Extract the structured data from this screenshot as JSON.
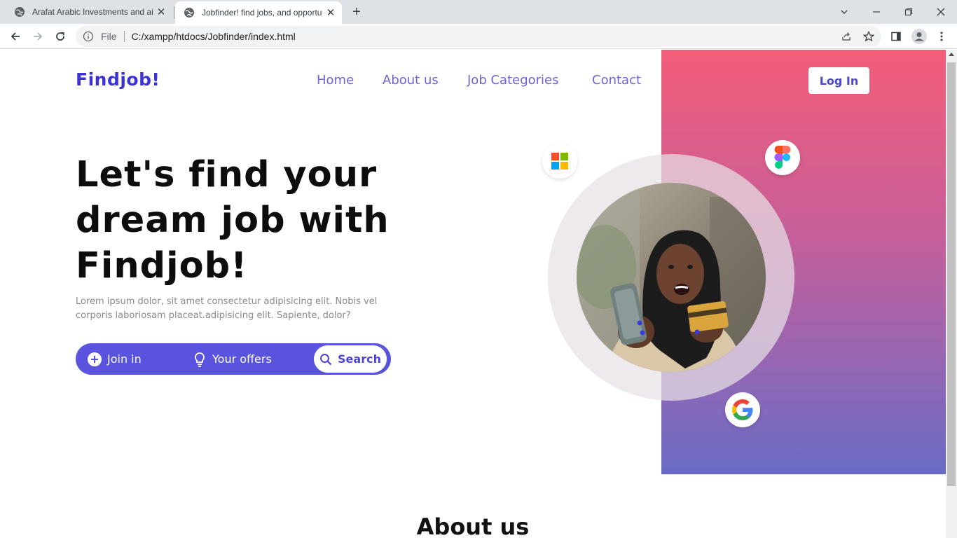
{
  "browser": {
    "tabs": [
      {
        "title": "Arafat Arabic Investments and ai",
        "active": false
      },
      {
        "title": "Jobfinder! find jobs, and opportu",
        "active": true
      }
    ],
    "new_tab": "+",
    "address": {
      "scheme_label": "File",
      "url": "C:/xampp/htdocs/Jobfinder/index.html"
    }
  },
  "header": {
    "brand": "Findjob!",
    "nav": [
      "Home",
      "About us",
      "Job Categories",
      "Contact"
    ],
    "login": "Log In"
  },
  "hero": {
    "title_lines": [
      "Let's find your",
      "dream job with",
      "Findjob!"
    ],
    "description": "Lorem ipsum dolor, sit amet consectetur adipisicing elit. Nobis vel corporis laboriosam placeat.adipisicing elit. Sapiente, dolor?",
    "actions": {
      "join": "Join in",
      "offers": "Your offers",
      "search": "Search"
    }
  },
  "logos": [
    "microsoft-icon",
    "figma-icon",
    "google-icon"
  ],
  "about": {
    "heading": "About us"
  },
  "colors": {
    "brand": "#3b33d6",
    "accent": "#5a53dd",
    "gradient_top": "#f45d79",
    "gradient_bottom": "#6a6bc4"
  }
}
